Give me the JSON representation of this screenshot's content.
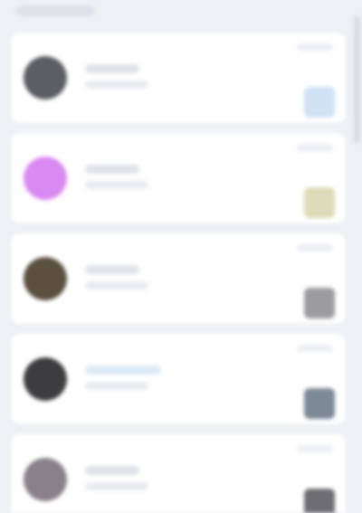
{
  "header": {
    "label": ""
  },
  "items": [
    {
      "avatar_color": "#5c5e63",
      "thumb_color": "#cfe3f5",
      "title": "",
      "subtitle": "",
      "meta": ""
    },
    {
      "avatar_color": "#d98af0",
      "thumb_color": "#dcdcb8",
      "title": "",
      "subtitle": "",
      "meta": ""
    },
    {
      "avatar_color": "#5b5040",
      "thumb_color": "#9c9c9e",
      "title": "",
      "subtitle": "",
      "meta": ""
    },
    {
      "avatar_color": "#3d3d40",
      "thumb_color": "#7c8a98",
      "title": "",
      "subtitle": "",
      "meta": ""
    },
    {
      "avatar_color": "#8a8089",
      "thumb_color": "#6e6e72",
      "title": "",
      "subtitle": "",
      "meta": ""
    }
  ]
}
